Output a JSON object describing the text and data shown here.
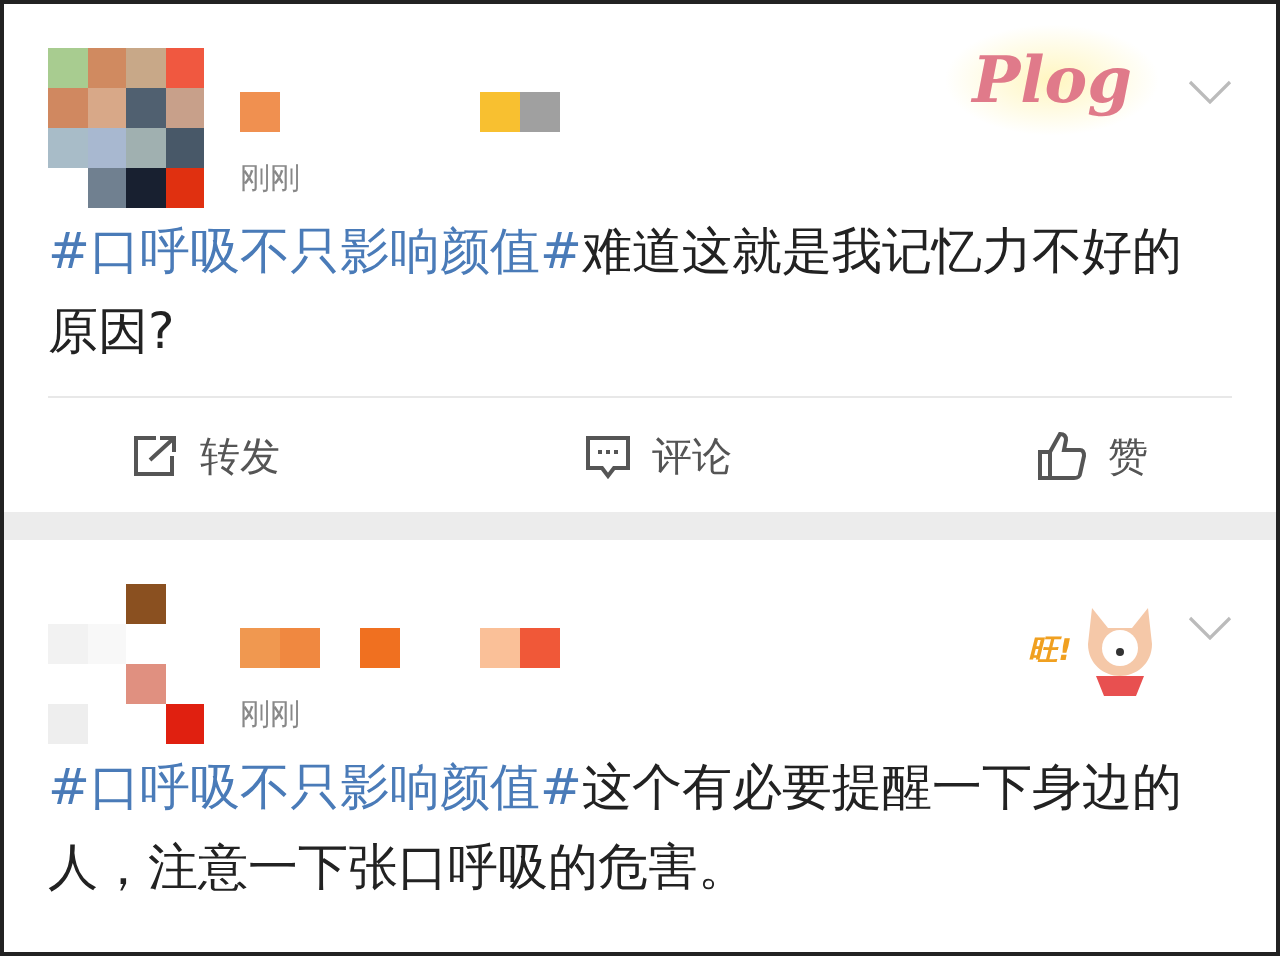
{
  "posts": [
    {
      "time": "刚刚",
      "sticker": {
        "kind": "plog",
        "text": "Plog"
      },
      "hashtag": "#口呼吸不只影响颜值#",
      "text": "难道这就是我记忆力不好的原因?",
      "actions": [
        {
          "kind": "share",
          "label": "转发"
        },
        {
          "kind": "comment",
          "label": "评论"
        },
        {
          "kind": "like",
          "label": "赞"
        }
      ]
    },
    {
      "time": "刚刚",
      "sticker": {
        "kind": "fox",
        "text": "旺!"
      },
      "hashtag": "#口呼吸不只影响颜值#",
      "text": "这个有必要提醒一下身边的人，注意一下张口呼吸的危害。"
    }
  ]
}
